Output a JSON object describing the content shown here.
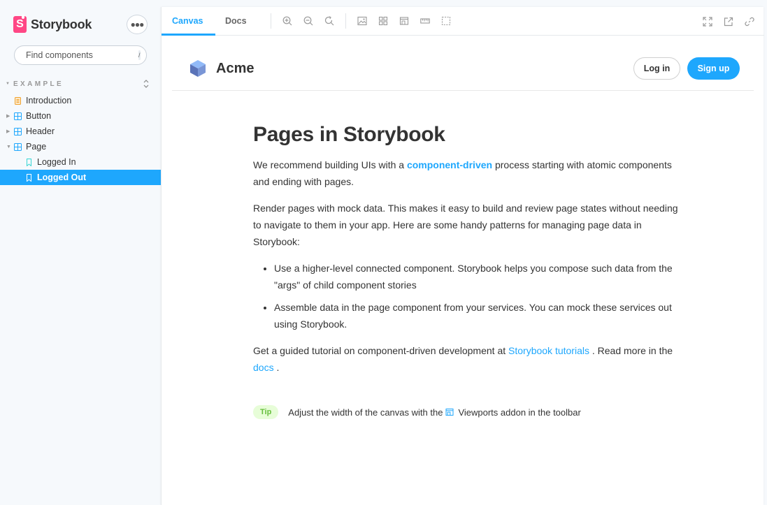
{
  "brand": {
    "name": "Storybook",
    "logo_letter": "S",
    "color": "#ff4785"
  },
  "sidebar": {
    "search_placeholder": "Find components",
    "search_shortcut": "/",
    "section": "EXAMPLE",
    "items": [
      {
        "label": "Introduction",
        "icon": "document-icon",
        "level": 0
      },
      {
        "label": "Button",
        "icon": "component-icon",
        "level": 0,
        "expandable": true
      },
      {
        "label": "Header",
        "icon": "component-icon",
        "level": 0,
        "expandable": true
      },
      {
        "label": "Page",
        "icon": "component-icon",
        "level": 0,
        "expanded": true
      },
      {
        "label": "Logged In",
        "icon": "bookmark-icon",
        "level": 1
      },
      {
        "label": "Logged Out",
        "icon": "bookmark-icon",
        "level": 1,
        "selected": true
      }
    ]
  },
  "toolbar": {
    "tabs": [
      {
        "label": "Canvas",
        "active": true
      },
      {
        "label": "Docs",
        "active": false
      }
    ],
    "tools": [
      "zoom-in-icon",
      "zoom-out-icon",
      "zoom-reset-icon",
      "background-icon",
      "grid-icon",
      "viewport-icon",
      "measure-icon",
      "outline-icon"
    ],
    "right_tools": [
      "fullscreen-icon",
      "open-new-tab-icon",
      "copy-link-icon"
    ]
  },
  "preview": {
    "header": {
      "title": "Acme",
      "login_label": "Log in",
      "signup_label": "Sign up"
    },
    "heading": "Pages in Storybook",
    "p1_before": "We recommend building UIs with a ",
    "p1_link": "component-driven",
    "p1_after": " process starting with atomic components and ending with pages.",
    "p2": "Render pages with mock data. This makes it easy to build and review page states without needing to navigate to them in your app. Here are some handy patterns for managing page data in Storybook:",
    "bullets": [
      "Use a higher-level connected component. Storybook helps you compose such data from the \"args\" of child component stories",
      "Assemble data in the page component from your services. You can mock these services out using Storybook."
    ],
    "p3_before": "Get a guided tutorial on component-driven development at ",
    "p3_link1": "Storybook tutorials",
    "p3_middle": " . Read more in the ",
    "p3_link2": "docs",
    "p3_after": " .",
    "tip_label": "Tip",
    "tip_before": "Adjust the width of the canvas with the",
    "tip_after": "Viewports addon in the toolbar"
  },
  "colors": {
    "accent": "#1ea7fd",
    "tip_bg": "#e7fdd8",
    "tip_text": "#66bf3c"
  }
}
